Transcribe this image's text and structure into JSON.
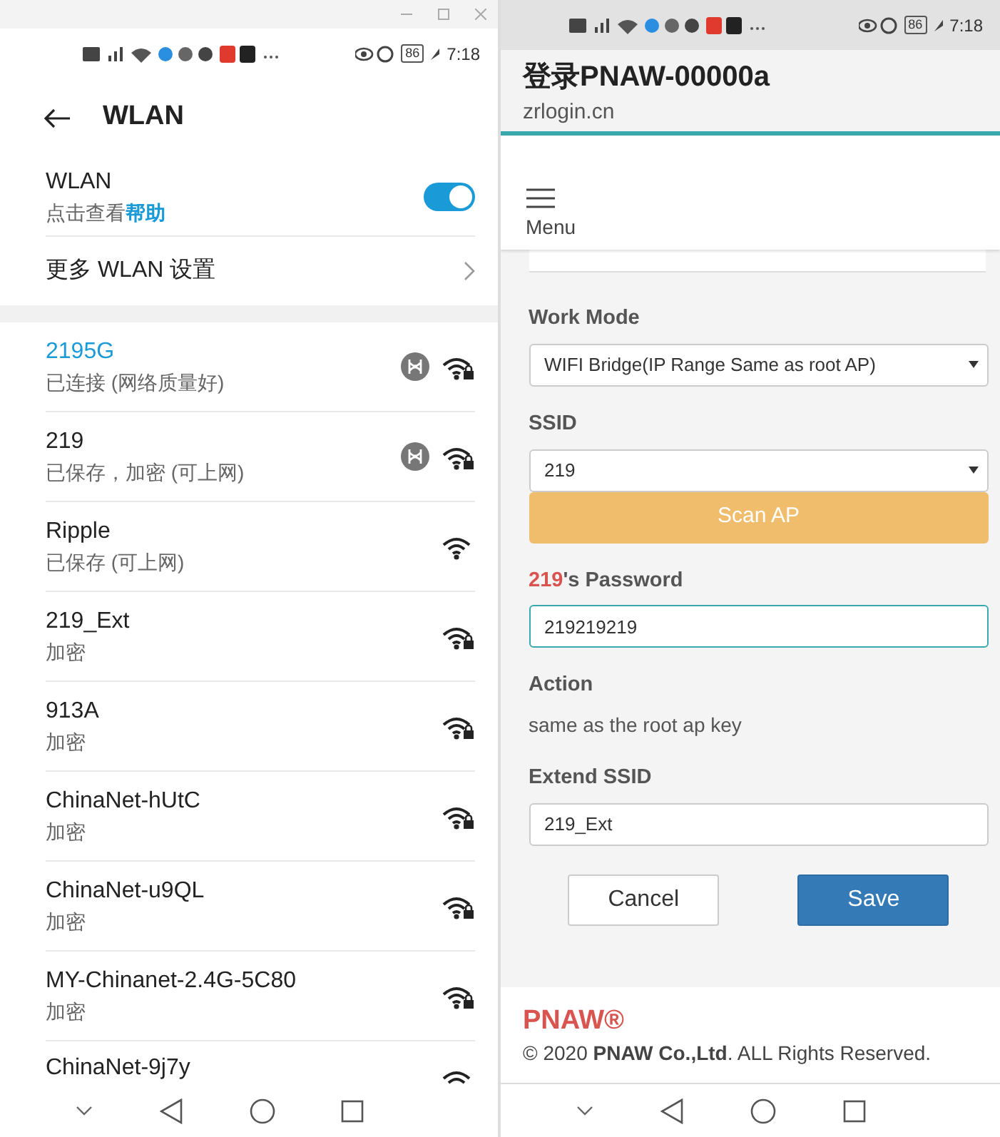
{
  "left": {
    "status_bar": {
      "battery": "86",
      "time": "7:18"
    },
    "header": {
      "title": "WLAN"
    },
    "wlan": {
      "label": "WLAN",
      "hint": "点击查看**帮助**",
      "on": true
    },
    "more_settings": {
      "label": "更多 WLAN 设置"
    },
    "networks": [
      {
        "name": "2195G",
        "status": "已连接 (网络质量好)",
        "connected": true,
        "secured": true,
        "hilink": true
      },
      {
        "name": "219",
        "status": "已保存，加密 (可上网)",
        "connected": false,
        "secured": true,
        "hilink": true
      },
      {
        "name": "Ripple",
        "status": "已保存 (可上网)",
        "connected": false,
        "secured": false,
        "hilink": false
      },
      {
        "name": "219_Ext",
        "status": "加密",
        "connected": false,
        "secured": true,
        "hilink": false
      },
      {
        "name": "913A",
        "status": "加密",
        "connected": false,
        "secured": true,
        "hilink": false
      },
      {
        "name": "ChinaNet-hUtC",
        "status": "加密",
        "connected": false,
        "secured": true,
        "hilink": false
      },
      {
        "name": "ChinaNet-u9QL",
        "status": "加密",
        "connected": false,
        "secured": true,
        "hilink": false
      },
      {
        "name": "MY-Chinanet-2.4G-5C80",
        "status": "加密",
        "connected": false,
        "secured": true,
        "hilink": false
      },
      {
        "name": "ChinaNet-9j7y",
        "connected": false,
        "hilink": false
      }
    ]
  },
  "right": {
    "status_bar": {
      "battery": "86",
      "time": "7:18"
    },
    "browser": {
      "title": "登录PNAW-00000a",
      "url": "zrlogin.cn"
    },
    "menu": {
      "label": "Menu"
    },
    "form": {
      "work_mode": {
        "label": "Work Mode",
        "value": "WIFI Bridge(IP Range Same as root AP)"
      },
      "ssid": {
        "label": "SSID",
        "value": "219"
      },
      "scan_button": "Scan AP",
      "password": {
        "label_ssid": "219",
        "label_rest": "'s Password",
        "value": "219219219"
      },
      "action": {
        "label": "Action",
        "text": "same as the root ap key"
      },
      "extend_ssid": {
        "label": "Extend SSID",
        "value": "219_Ext"
      },
      "buttons": [
        {
          "label": "Cancel",
          "kind": "secondary"
        },
        {
          "label": "Save",
          "kind": "primary"
        }
      ]
    },
    "footer": {
      "brand": "PNAW®",
      "copyright": "© 2020 **PNAW Co.,Ltd**. ALL Rights Reserved."
    }
  }
}
